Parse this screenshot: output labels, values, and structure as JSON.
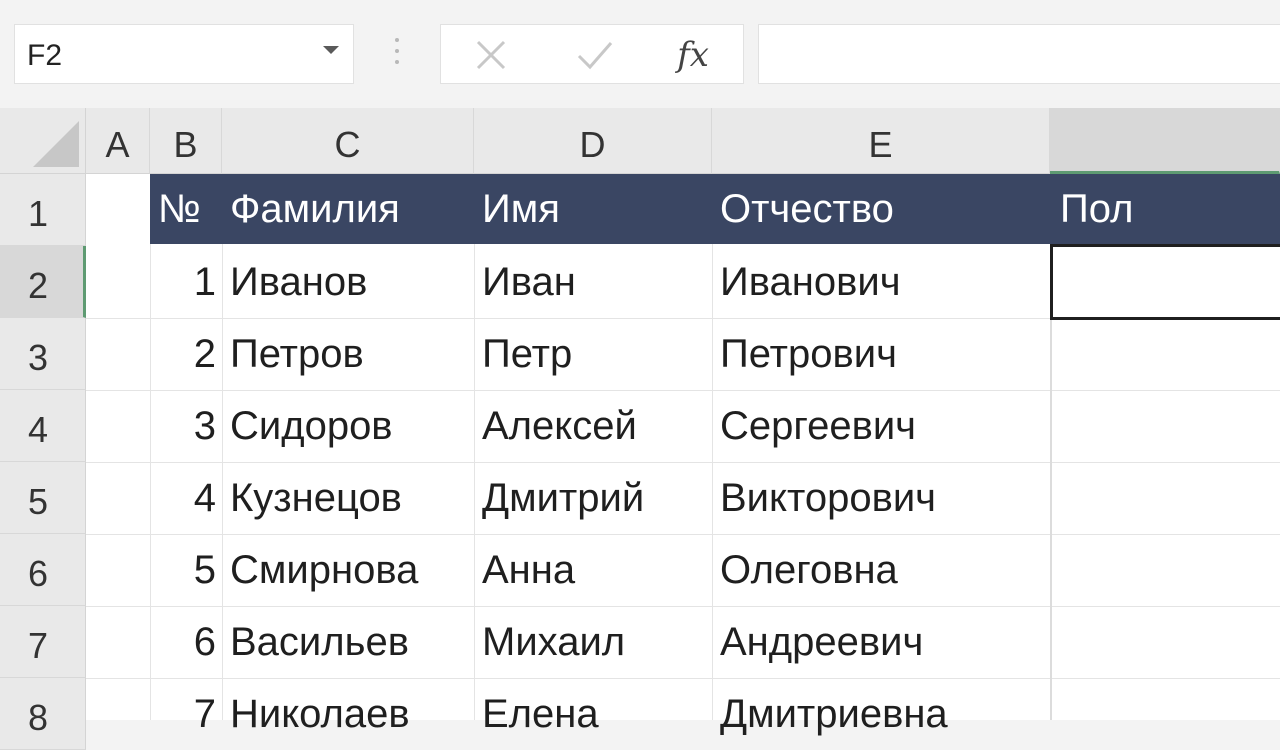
{
  "name_box": {
    "value": "F2"
  },
  "formula_bar": {
    "fx_label": "fx",
    "value": ""
  },
  "columns": [
    {
      "label": "A",
      "selected": false
    },
    {
      "label": "B",
      "selected": false
    },
    {
      "label": "C",
      "selected": false
    },
    {
      "label": "D",
      "selected": false
    },
    {
      "label": "E",
      "selected": false
    },
    {
      "label": "",
      "selected": true
    }
  ],
  "rows": [
    {
      "label": "1",
      "selected": false
    },
    {
      "label": "2",
      "selected": true
    },
    {
      "label": "3",
      "selected": false
    },
    {
      "label": "4",
      "selected": false
    },
    {
      "label": "5",
      "selected": false
    },
    {
      "label": "6",
      "selected": false
    },
    {
      "label": "7",
      "selected": false
    },
    {
      "label": "8",
      "selected": false
    }
  ],
  "table": {
    "headers": [
      "№",
      "Фамилия",
      "Имя",
      "Отчество",
      "Пол"
    ],
    "records": [
      [
        "1",
        "Иванов",
        "Иван",
        "Иванович",
        ""
      ],
      [
        "2",
        "Петров",
        "Петр",
        "Петрович",
        ""
      ],
      [
        "3",
        "Сидоров",
        "Алексей",
        "Сергеевич",
        ""
      ],
      [
        "4",
        "Кузнецов",
        "Дмитрий",
        "Викторович",
        ""
      ],
      [
        "5",
        "Смирнова",
        "Анна",
        "Олеговна",
        ""
      ],
      [
        "6",
        "Васильев",
        "Михаил",
        "Андреевич",
        ""
      ],
      [
        "7",
        "Николаев",
        "Елена",
        "Дмитриевна",
        ""
      ]
    ]
  },
  "colors": {
    "header_band": "#3a4663",
    "selection_accent": "#5e9b72"
  }
}
